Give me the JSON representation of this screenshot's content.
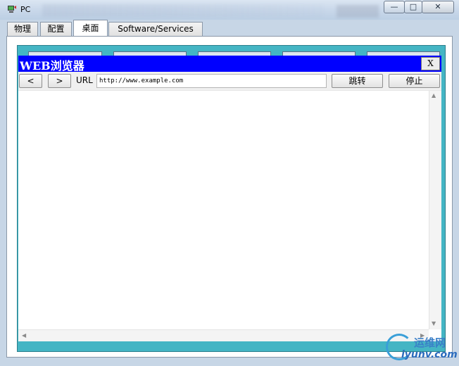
{
  "window": {
    "title": "PC",
    "controls": {
      "minimize": "—",
      "maximize": "□",
      "close": "✕"
    }
  },
  "tabs": [
    {
      "label": "物理"
    },
    {
      "label": "配置"
    },
    {
      "label": "桌面",
      "active": true
    },
    {
      "label": "Software/Services"
    }
  ],
  "browser": {
    "title": "WEB浏览器",
    "close_label": "X",
    "back_label": "<",
    "forward_label": ">",
    "url_label": "URL",
    "url_value": "http://www.example.com",
    "go_label": "跳转",
    "stop_label": "停止"
  },
  "watermark": {
    "text_cn": "运维网",
    "text_en": "iyunv.com"
  },
  "colors": {
    "browser_header": "#0000ff",
    "desktop_teal": "#44b5c4",
    "titlebar": "#c9d8ea"
  },
  "icons": [
    "pc-app-icon",
    "minimize-icon",
    "maximize-icon",
    "close-icon",
    "back-arrow-icon",
    "forward-arrow-icon",
    "scroll-up-icon",
    "scroll-down-icon",
    "scroll-left-icon",
    "scroll-right-icon"
  ]
}
